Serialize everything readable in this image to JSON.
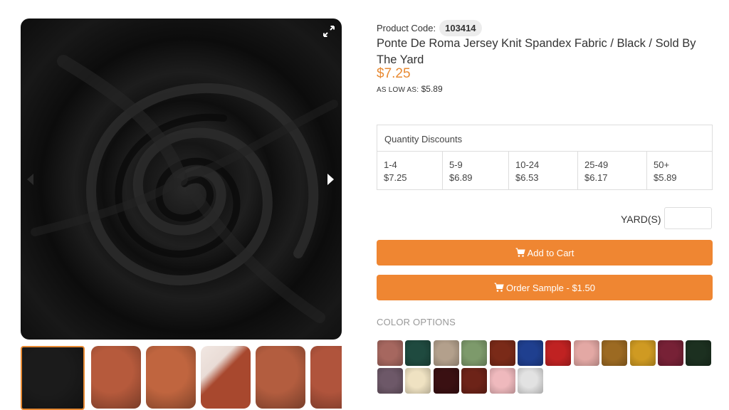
{
  "gallery": {
    "thumbnails": [
      {
        "name": "thumb-black",
        "color": "#1b1b1b"
      },
      {
        "name": "thumb-rust-1",
        "color": "#b65a3c"
      },
      {
        "name": "thumb-rust-2",
        "color": "#c0653f"
      },
      {
        "name": "thumb-rust-3",
        "color": "#a8482e"
      },
      {
        "name": "thumb-rust-4",
        "color": "#b35d3f"
      },
      {
        "name": "thumb-rust-5",
        "color": "#b0543c"
      }
    ]
  },
  "product": {
    "code_label": "Product Code:",
    "code_value": "103414",
    "title": "Ponte De Roma Jersey Knit Spandex Fabric / Black / Sold By The Yard",
    "price": "$7.25",
    "as_low_label": "AS LOW AS:",
    "as_low_value": "$5.89"
  },
  "quantity_discounts": {
    "header": "Quantity Discounts",
    "tiers": [
      {
        "range": "1-4",
        "price": "$7.25"
      },
      {
        "range": "5-9",
        "price": "$6.89"
      },
      {
        "range": "10-24",
        "price": "$6.53"
      },
      {
        "range": "25-49",
        "price": "$6.17"
      },
      {
        "range": "50+",
        "price": "$5.89"
      }
    ]
  },
  "purchase": {
    "unit_label": "YARD(S)",
    "quantity_value": "",
    "add_to_cart": "Add to Cart",
    "order_sample": "Order Sample - $1.50"
  },
  "colors": {
    "title": "COLOR OPTIONS",
    "swatches": [
      "#a6675f",
      "#1f4a3f",
      "#b3a08c",
      "#7d9a6b",
      "#7a2a18",
      "#1f3f8f",
      "#c02222",
      "#e3a8a4",
      "#9c6a22",
      "#cf9a22",
      "#772136",
      "#1c3020",
      "#6d5868",
      "#efe2c2",
      "#3a1012",
      "#6d2318",
      "#efb9bd",
      "#e2e2e2"
    ]
  }
}
